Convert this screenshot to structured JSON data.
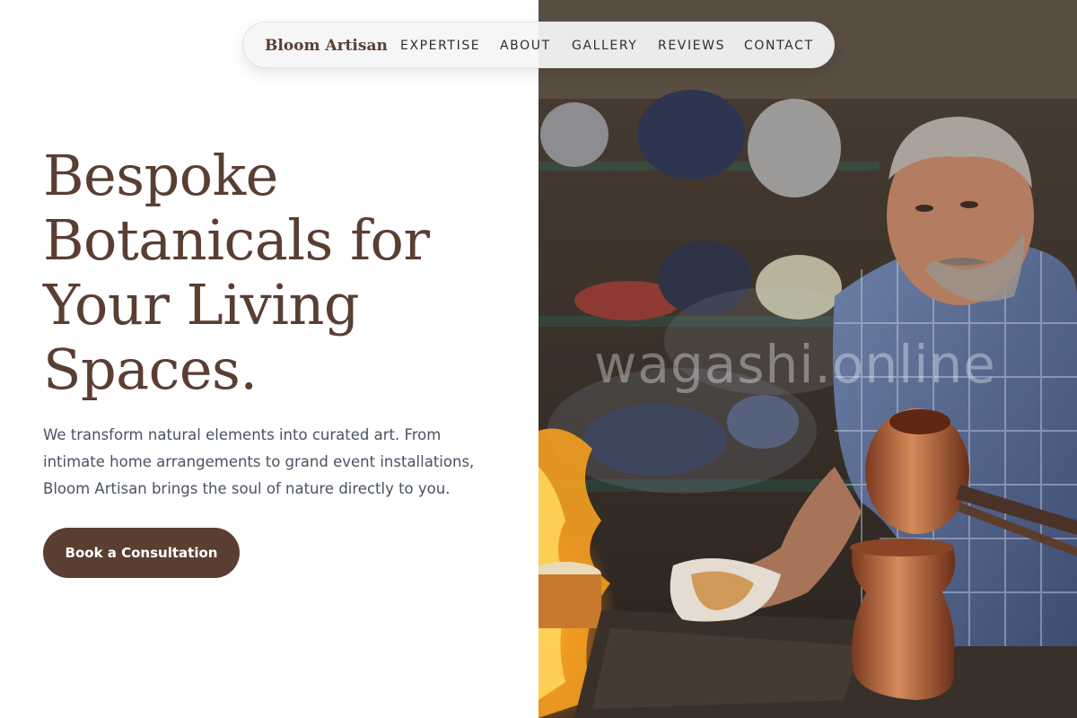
{
  "nav": {
    "brand": "Bloom Artisan",
    "links": [
      "EXPERTISE",
      "ABOUT",
      "GALLERY",
      "REVIEWS",
      "CONTACT"
    ]
  },
  "hero": {
    "title_lines": [
      "Bespoke",
      "Botanicals for",
      "Your Living",
      "Spaces."
    ],
    "description_lines": [
      "We transform natural elements into curated art. From",
      "intimate home arrangements to grand event installations,",
      "Bloom Artisan brings the soul of nature directly to you."
    ],
    "cta_label": "Book a Consultation"
  },
  "image": {
    "watermark": "wagashi.online"
  },
  "colors": {
    "brand": "#5a3e32",
    "body_text": "#4a5261",
    "nav_bg": "#f5f5f5"
  }
}
